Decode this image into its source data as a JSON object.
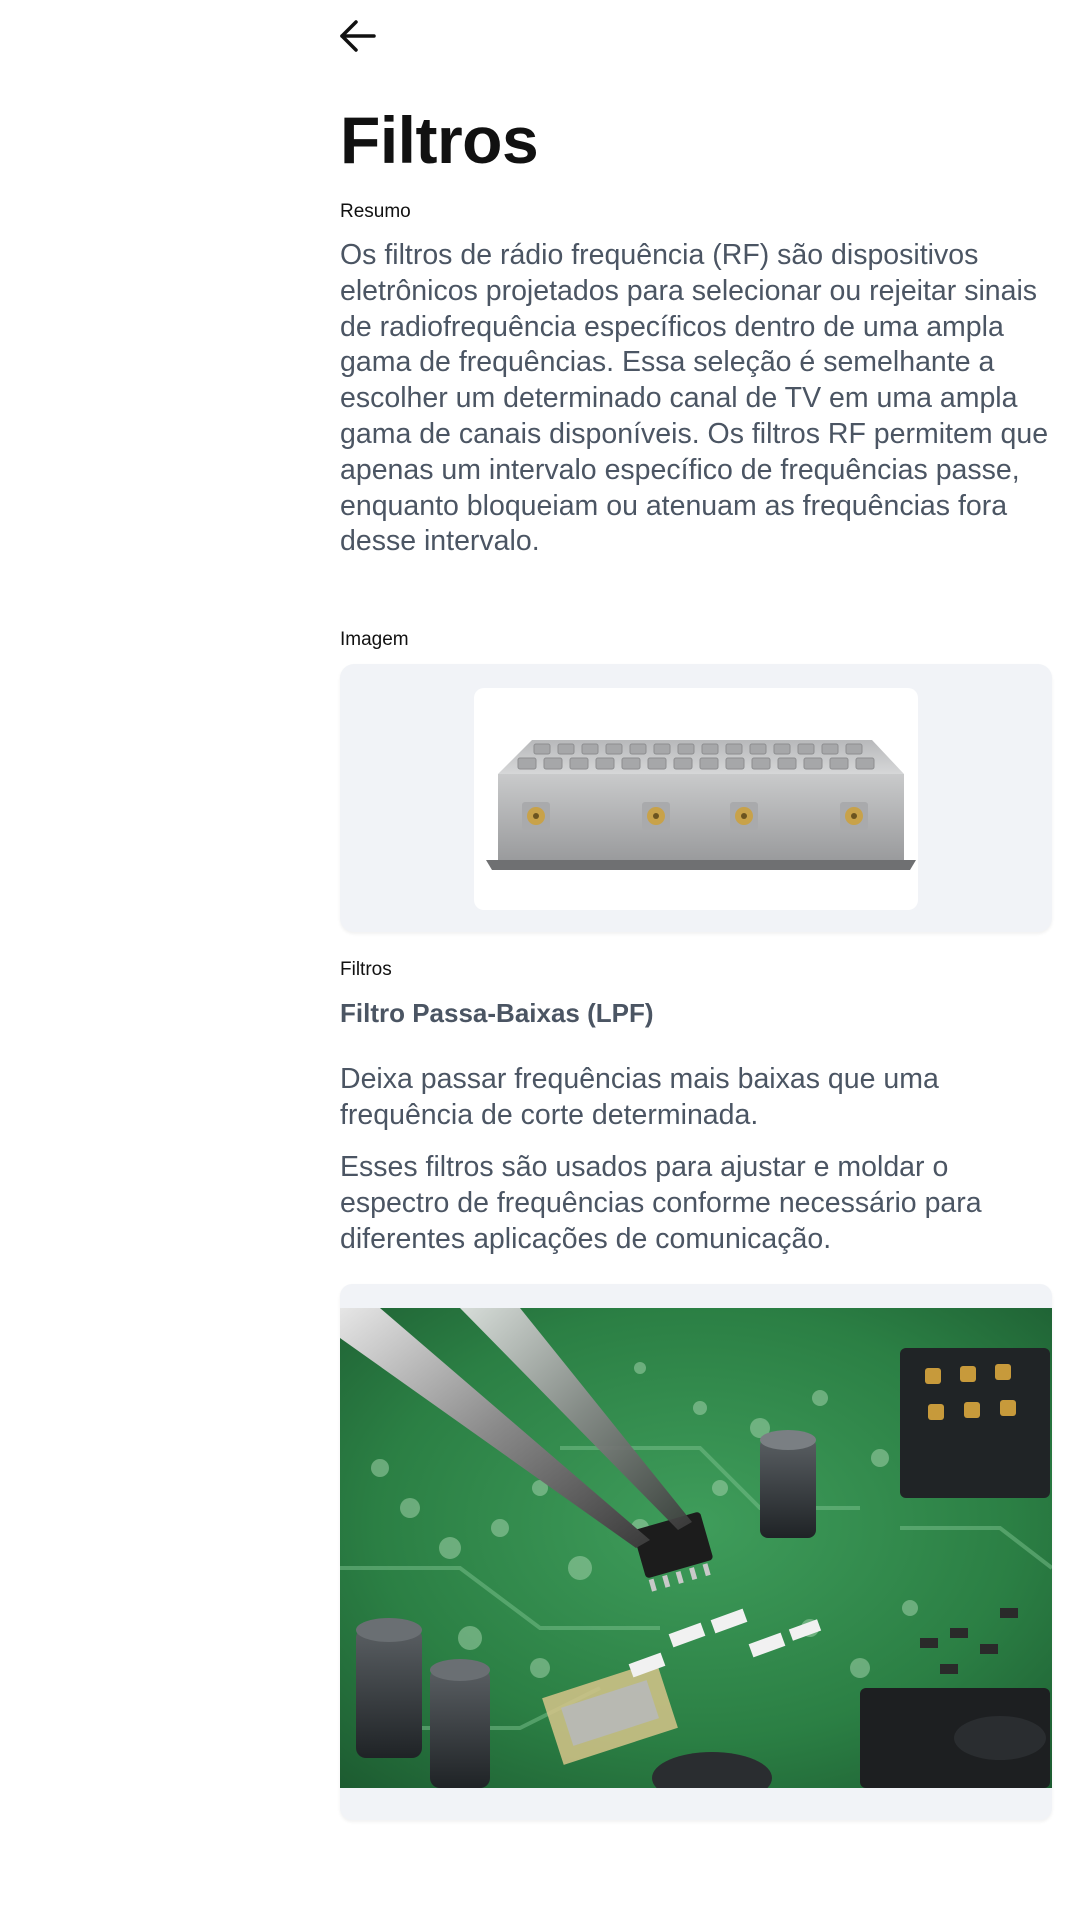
{
  "header": {
    "back_icon": "arrow-left-icon"
  },
  "page": {
    "title": "Filtros"
  },
  "summary": {
    "label": "Resumo",
    "text": "Os filtros de rádio frequência (RF) são dispositivos eletrônicos projetados para selecionar ou rejeitar sinais de radiofrequência específicos dentro de uma ampla gama de frequências. Essa seleção é semelhante a escolher um determinado canal de TV em uma ampla gama de canais disponíveis. Os filtros RF permitem que apenas um intervalo específico de frequências passe, enquanto bloqueiam ou atenuam as frequências fora desse intervalo."
  },
  "image_section": {
    "label": "Imagem"
  },
  "filters": {
    "label": "Filtros",
    "title": "Filtro Passa-Baixas (LPF)",
    "description": "Deixa passar frequências mais baixas que uma frequência de corte determinada.",
    "usage": "Esses filtros são usados para ajustar e moldar o espectro de frequências conforme necessário para diferentes aplicações de comunicação."
  },
  "colors": {
    "text_primary": "#111111",
    "text_secondary": "#4b5563",
    "card_background": "#f1f3f7",
    "pcb_green": "#2f8a4a"
  }
}
